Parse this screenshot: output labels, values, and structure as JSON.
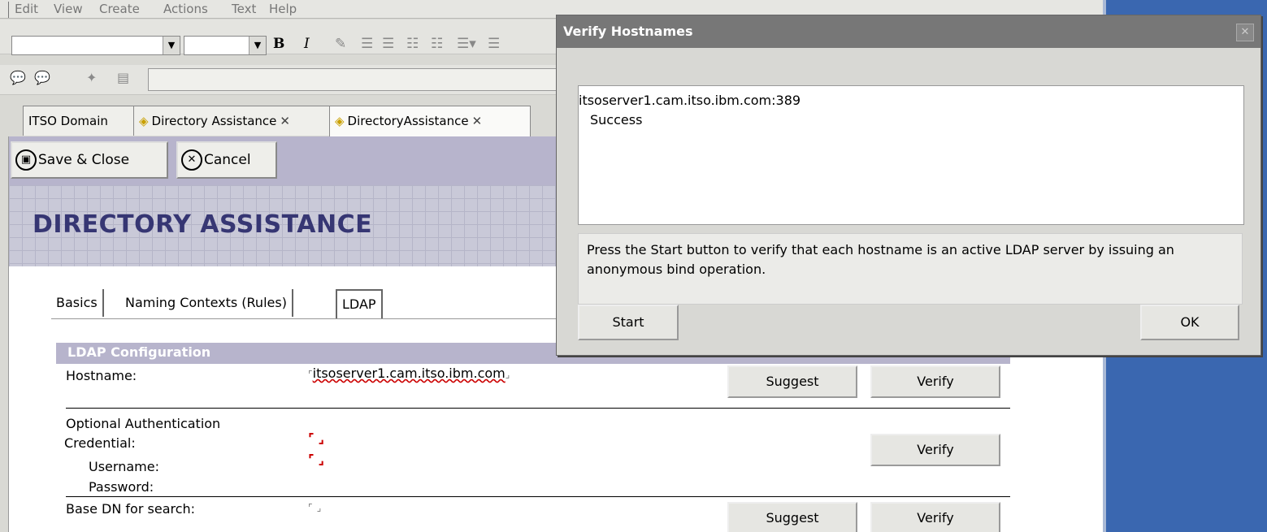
{
  "menu": [
    "Edit",
    "View",
    "Create",
    "Actions",
    "Text",
    "Help"
  ],
  "toolbar": {
    "bold": "B",
    "italic": "I"
  },
  "doc_tabs": [
    "ITSO Domain",
    "Directory Assistance",
    "DirectoryAssistance"
  ],
  "actions": {
    "save_close": "Save & Close",
    "cancel": "Cancel"
  },
  "banner_title": "DIRECTORY ASSISTANCE",
  "form_tabs": [
    "Basics",
    "Naming Contexts (Rules)",
    "LDAP"
  ],
  "section_title": "LDAP Configuration",
  "fields": {
    "hostname_label": "Hostname:",
    "hostname_value": "itsoserver1.cam.itso.ibm.com",
    "auth_label_1": "Optional Authentication",
    "auth_label_2": "Credential:",
    "username_label": "Username:",
    "password_label": "Password:",
    "basedn_label": "Base DN for search:"
  },
  "buttons": {
    "suggest": "Suggest",
    "verify": "Verify"
  },
  "dialog": {
    "title": "Verify Hostnames",
    "result_host": "itsoserver1.cam.itso.ibm.com:389",
    "result_status": "Success",
    "info": "Press the Start button to verify that each hostname is an active LDAP server by issuing an anonymous bind operation.",
    "start": "Start",
    "ok": "OK"
  }
}
